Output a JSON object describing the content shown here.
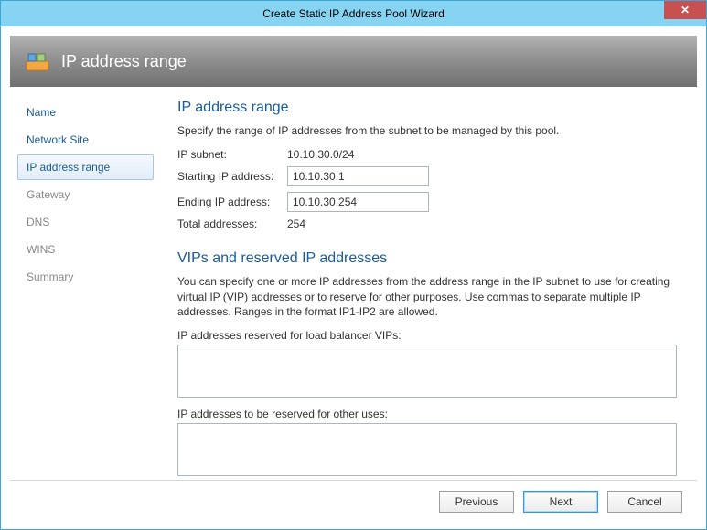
{
  "titlebar": {
    "title": "Create Static IP Address Pool Wizard",
    "close_glyph": "✕"
  },
  "header": {
    "title": "IP address range"
  },
  "sidebar": {
    "items": [
      {
        "label": "Name",
        "selected": false,
        "inactive": false
      },
      {
        "label": "Network Site",
        "selected": false,
        "inactive": false
      },
      {
        "label": "IP address range",
        "selected": true,
        "inactive": false
      },
      {
        "label": "Gateway",
        "selected": false,
        "inactive": true
      },
      {
        "label": "DNS",
        "selected": false,
        "inactive": true
      },
      {
        "label": "WINS",
        "selected": false,
        "inactive": true
      },
      {
        "label": "Summary",
        "selected": false,
        "inactive": true
      }
    ]
  },
  "content": {
    "section1": {
      "heading": "IP address range",
      "description": "Specify the range of IP addresses from the subnet to be managed by this pool.",
      "fields": {
        "subnet_label": "IP subnet:",
        "subnet_value": "10.10.30.0/24",
        "start_label": "Starting IP address:",
        "start_value": "10.10.30.1",
        "end_label": "Ending IP address:",
        "end_value": "10.10.30.254",
        "total_label": "Total addresses:",
        "total_value": "254"
      }
    },
    "section2": {
      "heading": "VIPs and reserved IP addresses",
      "description": "You can specify one or more IP addresses from the address range in the IP subnet to use for creating virtual IP (VIP) addresses or to reserve for other purposes. Use commas to separate multiple IP addresses. Ranges in the format IP1-IP2 are allowed.",
      "vips_label": "IP addresses reserved for load balancer VIPs:",
      "vips_value": "",
      "other_label": "IP addresses to be reserved for other uses:",
      "other_value": ""
    }
  },
  "footer": {
    "previous": "Previous",
    "next": "Next",
    "cancel": "Cancel"
  }
}
